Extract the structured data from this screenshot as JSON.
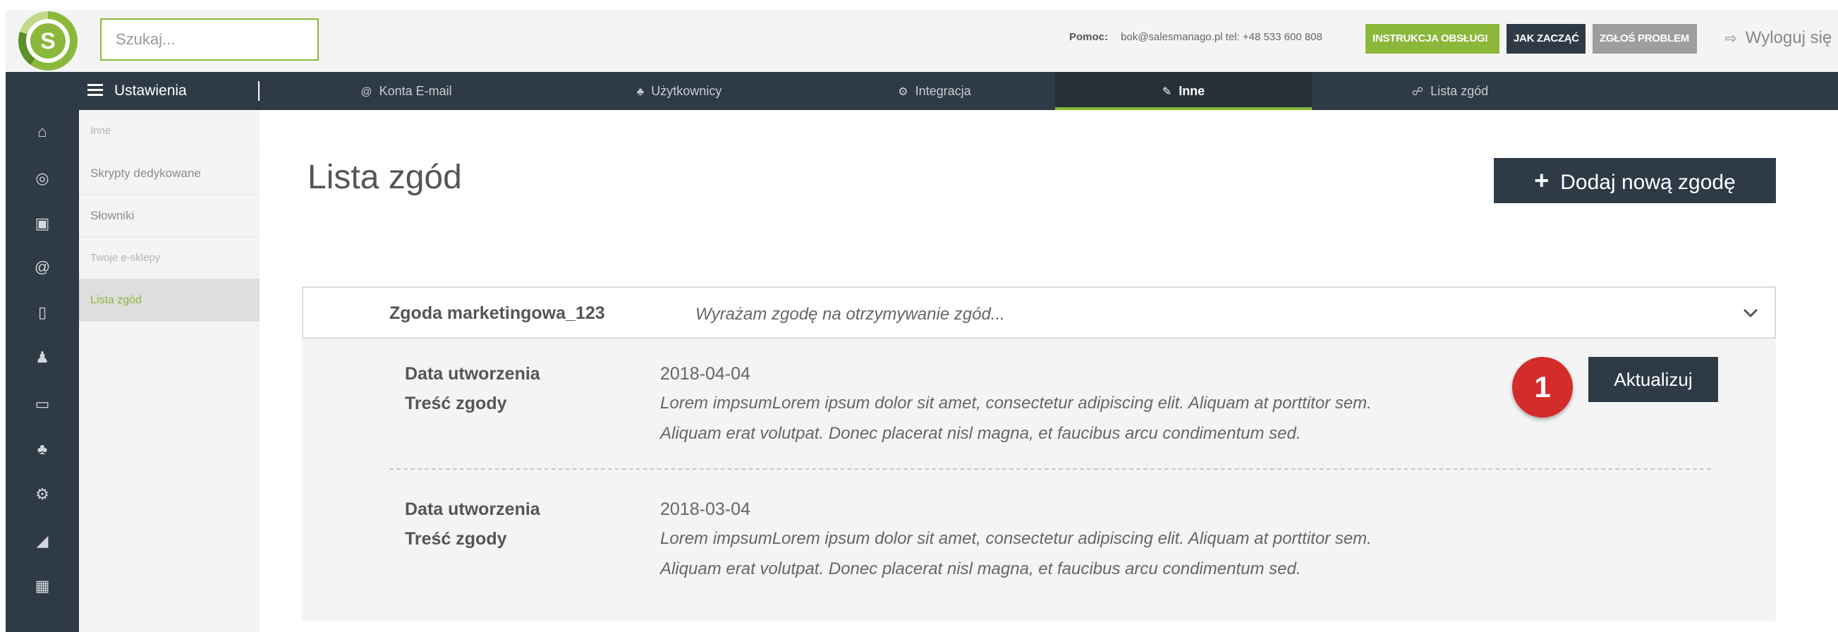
{
  "header": {
    "logo_letter": "S",
    "search_placeholder": "Szukaj...",
    "help_label": "Pomoc:",
    "help_contact": "bok@salesmanago.pl tel: +48 533 600 808",
    "btn_manual": "INSTRUKCJA OBSŁUGI",
    "btn_start": "JAK ZACZĄĆ",
    "btn_report": "ZGŁOŚ PROBLEM",
    "logout": "Wyloguj się",
    "colors": {
      "accent": "#8bb83a",
      "dark": "#2f3a47",
      "gray": "#9e9e9e"
    }
  },
  "nav": {
    "settings_label": "Ustawienia",
    "tabs": [
      {
        "label": "Konta E-mail",
        "icon": "at-icon"
      },
      {
        "label": "Użytkownicy",
        "icon": "users-icon"
      },
      {
        "label": "Integracja",
        "icon": "cogs-icon"
      },
      {
        "label": "Inne",
        "icon": "wrench-icon"
      },
      {
        "label": "Lista zgód",
        "icon": "handshake-icon"
      }
    ]
  },
  "iconbar": [
    "user-circle-icon",
    "home-icon",
    "eye-icon",
    "contact-card-icon",
    "at-icon",
    "mobile-icon",
    "user-plus-icon",
    "laptop-icon",
    "users-icon",
    "cogs-icon",
    "area-chart-icon",
    "calendar-icon"
  ],
  "submenu": {
    "items": [
      {
        "label": "Inne"
      },
      {
        "label": "Skrypty dedykowane"
      },
      {
        "label": "Słowniki"
      },
      {
        "label": "Twoje e-sklepy"
      },
      {
        "label": "Lista zgód"
      }
    ]
  },
  "main": {
    "title": "Lista zgód",
    "add_button": "Dodaj nową zgodę",
    "add_icon": "+",
    "consent": {
      "name": "Zgoda marketingowa_123",
      "description": "Wyrażam zgodę na otrzymywanie zgód...",
      "records": [
        {
          "date_label": "Data utworzenia",
          "date": "2018-04-04",
          "content_label": "Treść zgody",
          "content_line1": "Lorem impsumLorem ipsum dolor sit amet, consectetur adipiscing elit. Aliquam at porttitor sem.",
          "content_line2": "Aliquam erat volutpat. Donec placerat nisl magna, et faucibus arcu condimentum sed."
        },
        {
          "date_label": "Data utworzenia",
          "date": "2018-03-04",
          "content_label": "Treść zgody",
          "content_line1": "Lorem impsumLorem ipsum dolor sit amet, consectetur adipiscing elit. Aliquam at porttitor sem.",
          "content_line2": "Aliquam erat volutpat. Donec placerat nisl magna, et faucibus arcu condimentum sed."
        }
      ]
    },
    "update_button": "Aktualizuj",
    "marker_number": "1",
    "marker_color": "#d42b2b"
  }
}
